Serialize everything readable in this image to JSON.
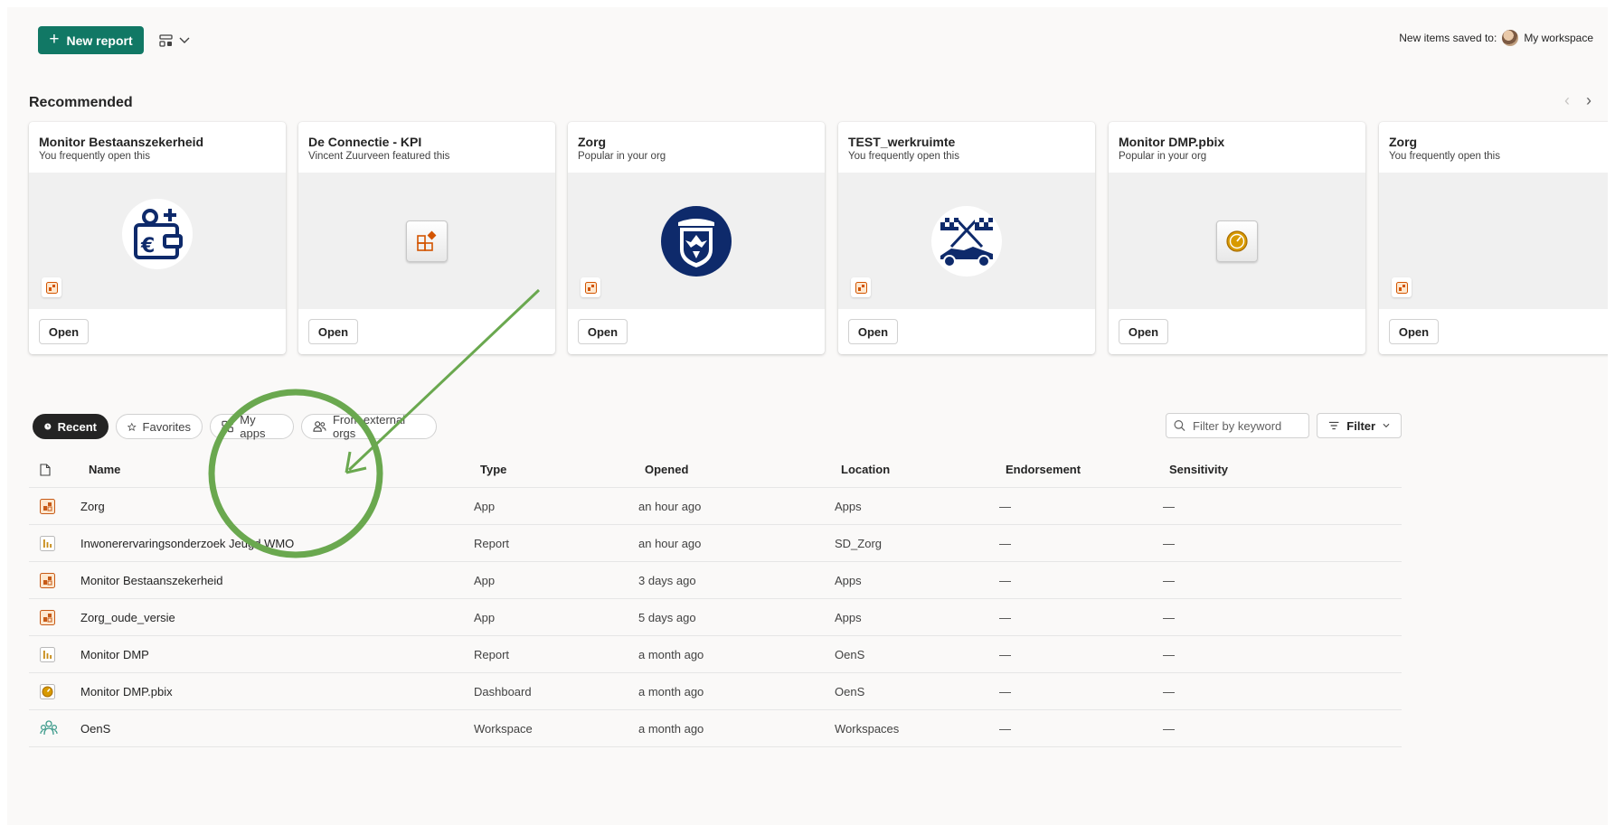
{
  "toolbar": {
    "new_report_label": "New report",
    "saved_to_label": "New items saved to:",
    "workspace_label": "My workspace"
  },
  "recommended": {
    "title": "Recommended",
    "cards": [
      {
        "title": "Monitor Bestaanszekerheid",
        "subtitle": "You frequently open this",
        "open_label": "Open",
        "art": "wallet-euro-icon"
      },
      {
        "title": "De Connectie - KPI",
        "subtitle": "Vincent Zuurveen featured this",
        "open_label": "Open",
        "art": "app-tile-icon"
      },
      {
        "title": "Zorg",
        "subtitle": "Popular in your org",
        "open_label": "Open",
        "art": "coat-of-arms-icon"
      },
      {
        "title": "TEST_werkruimte",
        "subtitle": "You frequently open this",
        "open_label": "Open",
        "art": "race-car-flags-icon"
      },
      {
        "title": "Monitor DMP.pbix",
        "subtitle": "Popular in your org",
        "open_label": "Open",
        "art": "dashboard-gauge-icon"
      },
      {
        "title": "Zorg",
        "subtitle": "You frequently open this",
        "open_label": "Open",
        "art": "app-icon"
      }
    ]
  },
  "pivots": [
    {
      "label": "Recent",
      "icon": "clock-icon",
      "active": true
    },
    {
      "label": "Favorites",
      "icon": "star-icon",
      "active": false
    },
    {
      "label": "My apps",
      "icon": "apps-grid-icon",
      "active": false
    },
    {
      "label": "From external orgs",
      "icon": "people-icon",
      "active": false
    }
  ],
  "filter": {
    "placeholder": "Filter by keyword",
    "button_label": "Filter"
  },
  "table": {
    "columns": [
      "Name",
      "Type",
      "Opened",
      "Location",
      "Endorsement",
      "Sensitivity"
    ],
    "rows": [
      {
        "icon": "app-icon",
        "name": "Zorg",
        "type": "App",
        "opened": "an hour ago",
        "location": "Apps",
        "endorsement": "—",
        "sensitivity": "—"
      },
      {
        "icon": "report-icon",
        "name": "Inwonerervaringsonderzoek Jeugd WMO",
        "type": "Report",
        "opened": "an hour ago",
        "location": "SD_Zorg",
        "endorsement": "—",
        "sensitivity": "—"
      },
      {
        "icon": "app-icon",
        "name": "Monitor Bestaanszekerheid",
        "type": "App",
        "opened": "3 days ago",
        "location": "Apps",
        "endorsement": "—",
        "sensitivity": "—"
      },
      {
        "icon": "app-icon",
        "name": "Zorg_oude_versie",
        "type": "App",
        "opened": "5 days ago",
        "location": "Apps",
        "endorsement": "—",
        "sensitivity": "—"
      },
      {
        "icon": "report-icon",
        "name": "Monitor DMP",
        "type": "Report",
        "opened": "a month ago",
        "location": "OenS",
        "endorsement": "—",
        "sensitivity": "—"
      },
      {
        "icon": "dashboard-icon",
        "name": "Monitor DMP.pbix",
        "type": "Dashboard",
        "opened": "a month ago",
        "location": "OenS",
        "endorsement": "—",
        "sensitivity": "—"
      },
      {
        "icon": "workspace-icon",
        "name": "OenS",
        "type": "Workspace",
        "opened": "a month ago",
        "location": "Workspaces",
        "endorsement": "—",
        "sensitivity": "—"
      }
    ]
  },
  "colors": {
    "primary": "#117865",
    "annotation": "#6aa84f",
    "brand_navy": "#0e2a6b",
    "app_orange": "#d35400"
  }
}
